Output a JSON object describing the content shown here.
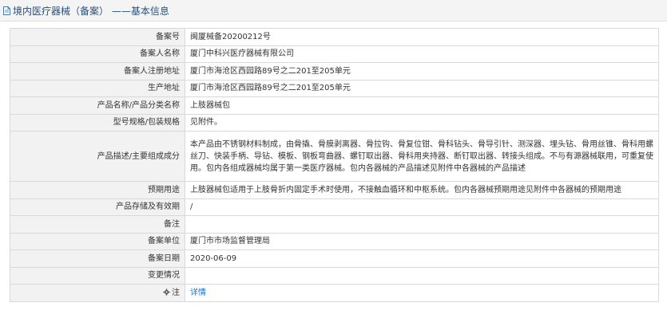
{
  "header": {
    "title": "境内医疗器械（备案） ——基本信息"
  },
  "rows": [
    {
      "label": "备案号",
      "value": "闽厦械备20200212号"
    },
    {
      "label": "备案人名称",
      "value": "厦门中科兴医疗器械有限公司"
    },
    {
      "label": "备案人注册地址",
      "value": "厦门市海沧区西园路89号之二201至205单元"
    },
    {
      "label": "生产地址",
      "value": "厦门市海沧区西园路89号之二201至205单元"
    },
    {
      "label": "产品名称/产品分类名称",
      "value": "上肢器械包"
    },
    {
      "label": "型号规格/包装规格",
      "value": "见附件。"
    },
    {
      "label": "产品描述/主要组成成分",
      "value": "本产品由不锈钢材料制成，由骨撬、骨膜剥离器、骨拉钩、骨复位钳、骨科钻头、骨导引针、测深器、埋头钻、骨用丝锥、骨科用螺丝刀、快装手柄、导钻、模板、钢板弯曲器、螺钉取出器、骨科用夹持器、断钉取出器、转接头组成。不与有源器械联用，可重复使用。包内各组成器械均属于第一类医疗器械。包内各器械的产品描述见附件中各器械的产品描述"
    },
    {
      "label": "预期用途",
      "value": "上肢器械包适用于上肢骨折内固定手术时使用，不接触血循环和中枢系统。包内各器械预期用途见附件中各器械的预期用途"
    },
    {
      "label": "产品存储及有效期",
      "value": "/"
    },
    {
      "label": "备注",
      "value": ""
    },
    {
      "label": "备案单位",
      "value": "厦门市市场监督管理局"
    },
    {
      "label": "备案日期",
      "value": "2020-06-09"
    },
    {
      "label": "变更情况",
      "value": ""
    },
    {
      "label": "注",
      "value": "详情"
    }
  ]
}
